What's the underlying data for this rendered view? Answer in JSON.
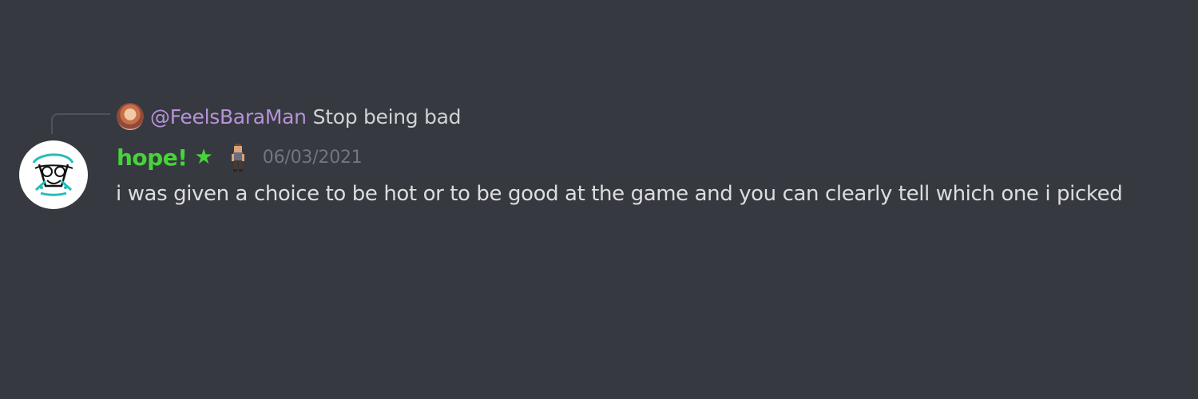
{
  "message": {
    "reply": {
      "author": "@FeelsBaraMan",
      "text": "Stop being bad"
    },
    "author": {
      "name": "hope!",
      "badge": "★"
    },
    "timestamp": "06/03/2021",
    "content": "i was given a choice to be hot or to be good at the game and you can clearly tell which one i picked"
  },
  "colors": {
    "background": "#36393f",
    "reply_author": "#b792da",
    "username": "#46d43a",
    "timestamp": "#72767d",
    "message_text": "#dcddde"
  },
  "icons": {
    "reply_avatar": "reply-avatar",
    "avatar": "avatar-sketch-icon",
    "role_icon": "pixel-character-icon"
  }
}
